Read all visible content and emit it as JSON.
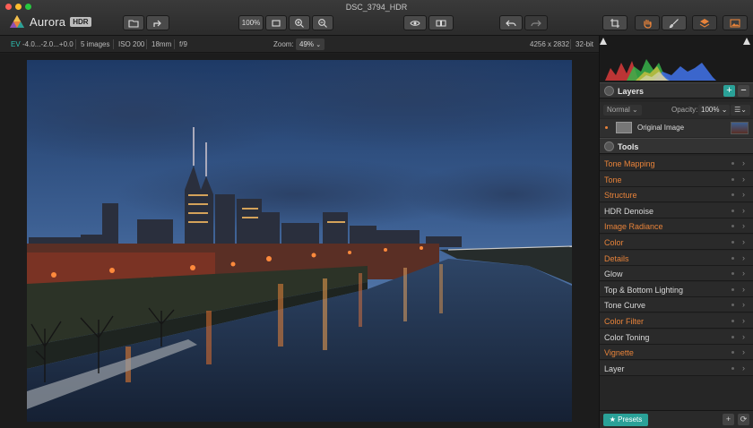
{
  "window": {
    "title": "DSC_3794_HDR"
  },
  "app": {
    "name": "Aurora",
    "badge": "HDR"
  },
  "toolbar": {
    "zoom_100": "100%",
    "icons": [
      "open-folder-icon",
      "share-icon",
      "fit-screen-icon",
      "zoom-in-icon",
      "zoom-out-icon",
      "eye-icon",
      "compare-icon",
      "undo-icon",
      "redo-icon",
      "crop-icon",
      "hand-icon",
      "brush-icon",
      "layers-icon",
      "image-icon"
    ]
  },
  "infobar": {
    "ev_label": "EV",
    "ev_value": "-4.0...-2.0...+0.0",
    "images": "5 images",
    "iso": "ISO 200",
    "focal": "18mm",
    "aperture": "f/9",
    "zoom_label": "Zoom:",
    "zoom_value": "49%",
    "resolution": "4256 x 2832",
    "bitdepth": "32-bit"
  },
  "panel": {
    "layers_title": "Layers",
    "blend_mode": "Normal",
    "opacity_label": "Opacity:",
    "opacity_value": "100%",
    "layer_name": "Original Image",
    "tools_title": "Tools",
    "tools": [
      {
        "name": "Tone Mapping",
        "color": "#e8833a"
      },
      {
        "name": "Tone",
        "color": "#e8833a"
      },
      {
        "name": "Structure",
        "color": "#e8833a"
      },
      {
        "name": "HDR Denoise",
        "color": "#d8d8d8"
      },
      {
        "name": "Image Radiance",
        "color": "#e8833a"
      },
      {
        "name": "Color",
        "color": "#e8833a"
      },
      {
        "name": "Details",
        "color": "#e8833a"
      },
      {
        "name": "Glow",
        "color": "#d8d8d8"
      },
      {
        "name": "Top & Bottom Lighting",
        "color": "#d8d8d8"
      },
      {
        "name": "Tone Curve",
        "color": "#d8d8d8"
      },
      {
        "name": "Color Filter",
        "color": "#e8833a"
      },
      {
        "name": "Color Toning",
        "color": "#d8d8d8"
      },
      {
        "name": "Vignette",
        "color": "#e8833a"
      },
      {
        "name": "Layer",
        "color": "#d8d8d8"
      }
    ],
    "presets_label": "★ Presets"
  },
  "colors": {
    "accent_teal": "#2aa198",
    "accent_orange": "#e8833a",
    "tool_white": "#d8d8d8"
  }
}
